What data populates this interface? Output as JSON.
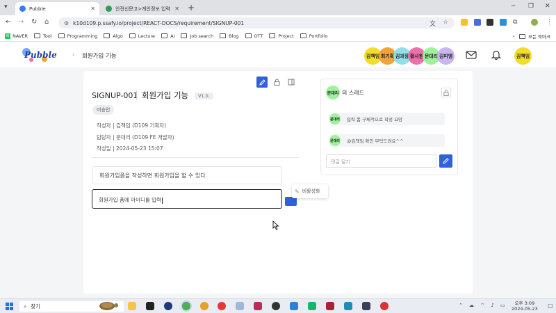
{
  "browser": {
    "tabs": [
      {
        "title": "Pubble",
        "active": true,
        "favicon_color": "#3b7bf0"
      },
      {
        "title": "안전신문고>개인정보 입력",
        "active": false,
        "favicon_color": "#2d9d5a"
      }
    ],
    "address_bar": {
      "url": "k10d109.p.ssafy.io/project/REACT-DOCS/requirement/SIGNUP-001"
    },
    "bookmarks": [
      "NAVER",
      "Tool",
      "Programming",
      "Algo",
      "Lecture",
      "AI",
      "Job search",
      "Blog",
      "OTT",
      "Project",
      "Portfolio"
    ],
    "all_bookmarks_label": "모든 북마크"
  },
  "header": {
    "logo_text": "Pubble",
    "breadcrumb_page": "회원가입 기능",
    "members": [
      {
        "name": "김책임",
        "color": "#f2dd2a"
      },
      {
        "name": "최기획",
        "color": "#f2a33a"
      },
      {
        "name": "김과장",
        "color": "#8fe0e8"
      },
      {
        "name": "황사원",
        "color": "#ee6fae"
      },
      {
        "name": "문대리",
        "color": "#9ff29b"
      },
      {
        "name": "김피엠",
        "color": "#c9b6ee"
      }
    ],
    "current_user": "김책임"
  },
  "requirement": {
    "code": "SIGNUP-001",
    "title": "회원가입 기능",
    "version": "V1.0.",
    "status": "미승인",
    "author": "작성자 | 김책임 (D109 기획자)",
    "assignee": "담당자 | 문대리 (D109 FE 개발자)",
    "created": "작성일 | 2024-05-23  15:07",
    "details": [
      {
        "text": "회원가입폼을 작성하면 회원가입을 할 수 있다."
      }
    ],
    "edit_value": "회원가입 폼에 아이디를 입력",
    "deactivate_label": "비활성화"
  },
  "thread": {
    "owner": "문대리",
    "title_suffix": "의 스레드",
    "comments": [
      {
        "author": "문대리",
        "text": "입력 폼 구체적으로 작성 요망"
      },
      {
        "author": "문대리",
        "text": "@김책임 확인 부탁드려요^^"
      }
    ],
    "input_placeholder": "댓글 달기"
  },
  "taskbar": {
    "search_label": "찾기",
    "time": "오후 3:09",
    "date": "2024-05-23"
  }
}
